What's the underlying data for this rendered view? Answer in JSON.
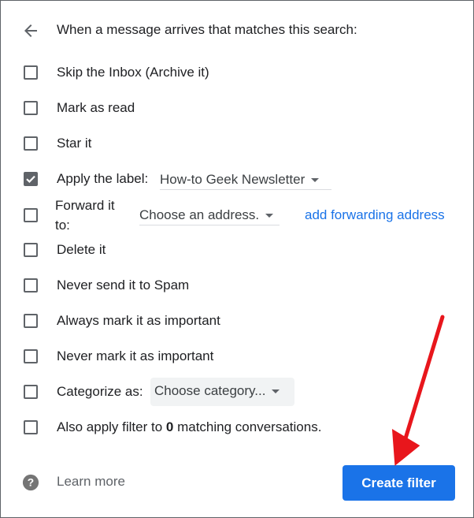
{
  "header": {
    "text": "When a message arrives that matches this search:"
  },
  "options": {
    "skip_inbox": "Skip the Inbox (Archive it)",
    "mark_as_read": "Mark as read",
    "star_it": "Star it",
    "apply_label": "Apply the label:",
    "apply_label_value": "How-to Geek Newsletter",
    "forward_line1": "Forward it",
    "forward_line2": "to:",
    "forward_value": "Choose an address.",
    "add_forwarding": "add forwarding address",
    "delete_it": "Delete it",
    "never_spam": "Never send it to Spam",
    "always_important": "Always mark it as important",
    "never_important": "Never mark it as important",
    "categorize": "Categorize as:",
    "categorize_value": "Choose category...",
    "also_apply_prefix": "Also apply filter to ",
    "also_apply_count": "0",
    "also_apply_suffix": " matching conversations."
  },
  "footer": {
    "learn_more": "Learn more",
    "create_filter": "Create filter"
  },
  "colors": {
    "accent": "#1a73e8",
    "annotation_arrow": "#e8161c"
  }
}
